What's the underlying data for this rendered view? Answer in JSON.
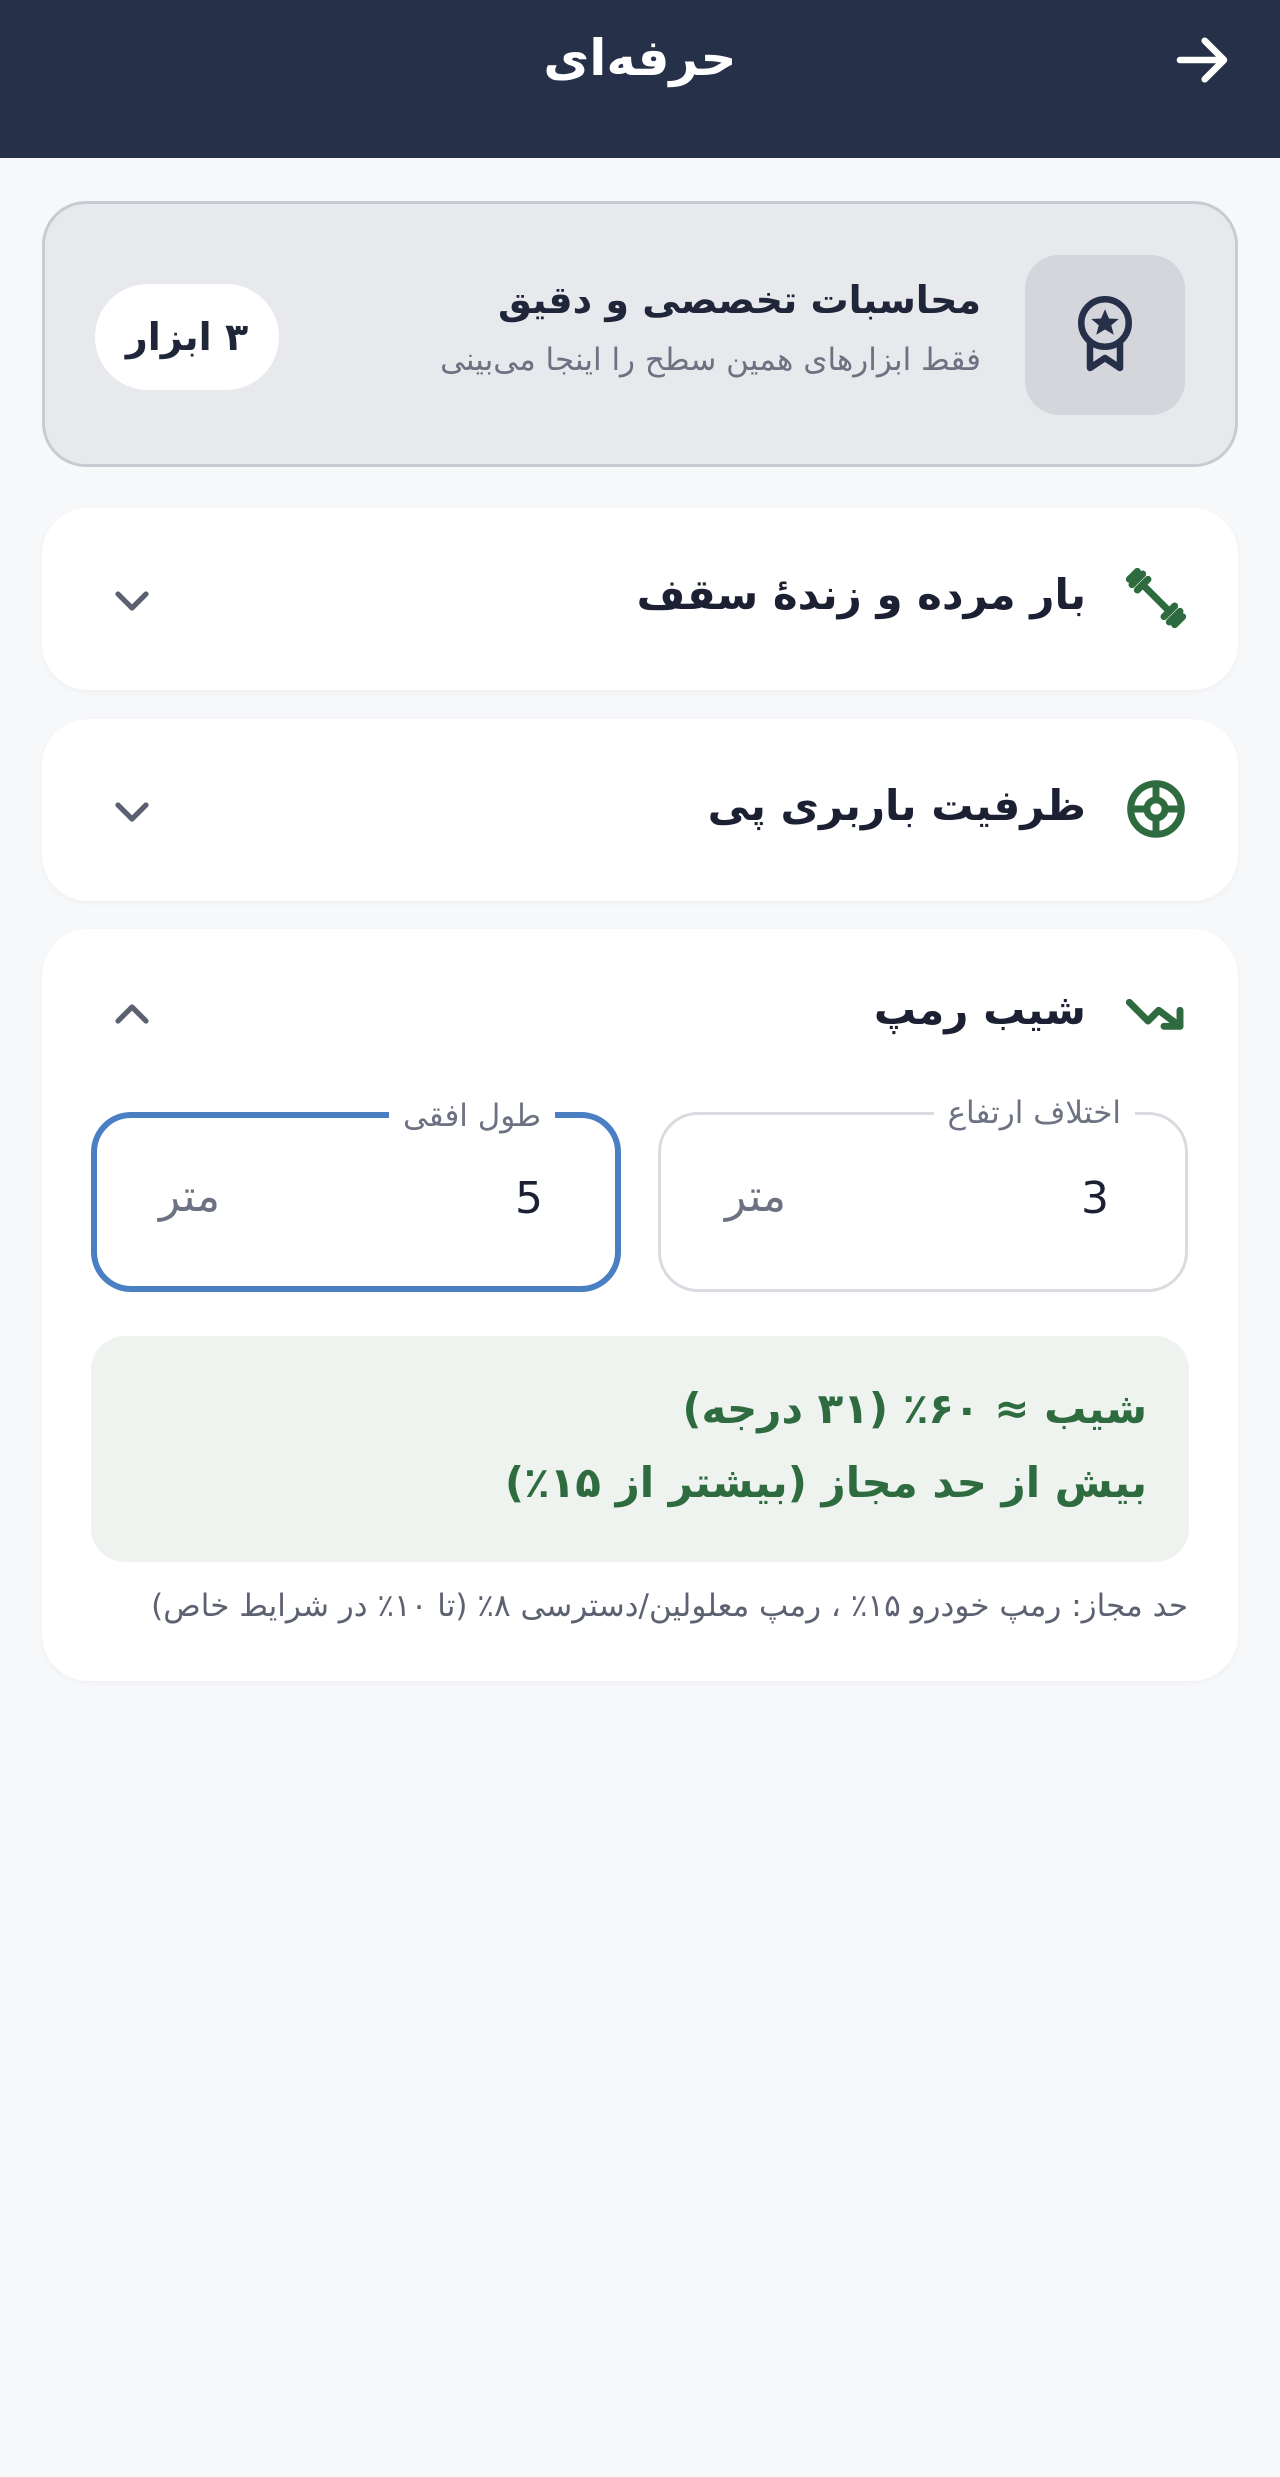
{
  "header": {
    "title": "حرفه‌ای",
    "back_icon": "arrow-right-icon"
  },
  "banner": {
    "icon": "award-icon",
    "title": "محاسبات تخصصی و دقیق",
    "subtitle": "فقط ابزارهای همین سطح را اینجا می‌بینی",
    "badge": "۳ ابزار"
  },
  "tools": [
    {
      "title": "بار مرده و زندهٔ سقف",
      "icon": "dumbbell-icon",
      "expanded": false
    },
    {
      "title": "ظرفیت باربری پی",
      "icon": "foundation-icon",
      "expanded": false
    },
    {
      "title": "شیب رمپ",
      "icon": "trending-icon",
      "expanded": true
    }
  ],
  "ramp": {
    "height_field": {
      "label": "اختلاف ارتفاع",
      "value": "3",
      "unit": "متر"
    },
    "length_field": {
      "label": "طول افقی",
      "value": "5",
      "unit": "متر"
    },
    "result_line1": "شیب ≈ ۶۰٪ (۳۱ درجه)",
    "result_line2": "بیش از حد مجاز (بیشتر از ۱۵٪)",
    "note": "حد مجاز: رمپ خودرو ۱۵٪ ، رمپ معلولین/دسترسی ۸٪ (تا ۱۰٪ در شرایط خاص)"
  },
  "colors": {
    "appbar": "#273049",
    "accent_green": "#2e6b3f",
    "focus_blue": "#4a7fc4"
  }
}
